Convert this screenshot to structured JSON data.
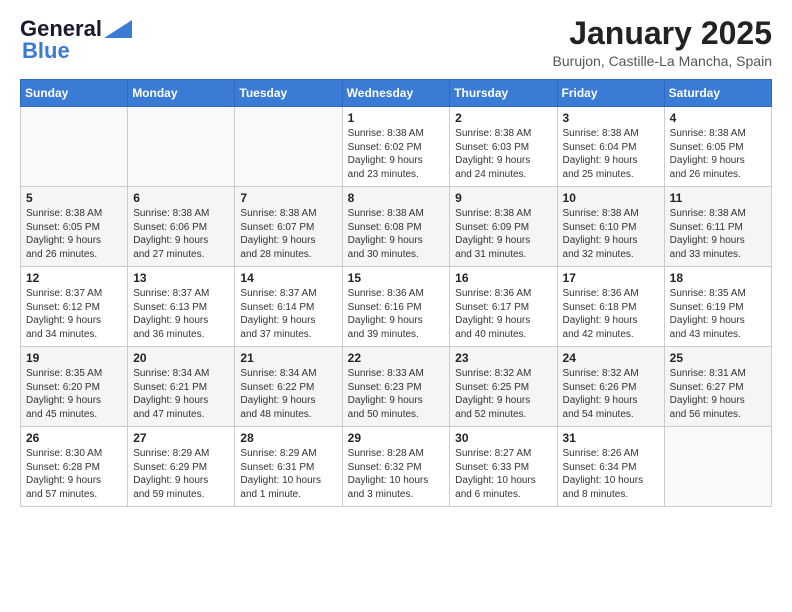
{
  "header": {
    "logo_blue": "Blue",
    "month_title": "January 2025",
    "subtitle": "Burujon, Castille-La Mancha, Spain"
  },
  "calendar": {
    "days": [
      "Sunday",
      "Monday",
      "Tuesday",
      "Wednesday",
      "Thursday",
      "Friday",
      "Saturday"
    ]
  },
  "weeks": [
    [
      {
        "day": "",
        "info": ""
      },
      {
        "day": "",
        "info": ""
      },
      {
        "day": "",
        "info": ""
      },
      {
        "day": "1",
        "info": "Sunrise: 8:38 AM\nSunset: 6:02 PM\nDaylight: 9 hours\nand 23 minutes."
      },
      {
        "day": "2",
        "info": "Sunrise: 8:38 AM\nSunset: 6:03 PM\nDaylight: 9 hours\nand 24 minutes."
      },
      {
        "day": "3",
        "info": "Sunrise: 8:38 AM\nSunset: 6:04 PM\nDaylight: 9 hours\nand 25 minutes."
      },
      {
        "day": "4",
        "info": "Sunrise: 8:38 AM\nSunset: 6:05 PM\nDaylight: 9 hours\nand 26 minutes."
      }
    ],
    [
      {
        "day": "5",
        "info": "Sunrise: 8:38 AM\nSunset: 6:05 PM\nDaylight: 9 hours\nand 26 minutes."
      },
      {
        "day": "6",
        "info": "Sunrise: 8:38 AM\nSunset: 6:06 PM\nDaylight: 9 hours\nand 27 minutes."
      },
      {
        "day": "7",
        "info": "Sunrise: 8:38 AM\nSunset: 6:07 PM\nDaylight: 9 hours\nand 28 minutes."
      },
      {
        "day": "8",
        "info": "Sunrise: 8:38 AM\nSunset: 6:08 PM\nDaylight: 9 hours\nand 30 minutes."
      },
      {
        "day": "9",
        "info": "Sunrise: 8:38 AM\nSunset: 6:09 PM\nDaylight: 9 hours\nand 31 minutes."
      },
      {
        "day": "10",
        "info": "Sunrise: 8:38 AM\nSunset: 6:10 PM\nDaylight: 9 hours\nand 32 minutes."
      },
      {
        "day": "11",
        "info": "Sunrise: 8:38 AM\nSunset: 6:11 PM\nDaylight: 9 hours\nand 33 minutes."
      }
    ],
    [
      {
        "day": "12",
        "info": "Sunrise: 8:37 AM\nSunset: 6:12 PM\nDaylight: 9 hours\nand 34 minutes."
      },
      {
        "day": "13",
        "info": "Sunrise: 8:37 AM\nSunset: 6:13 PM\nDaylight: 9 hours\nand 36 minutes."
      },
      {
        "day": "14",
        "info": "Sunrise: 8:37 AM\nSunset: 6:14 PM\nDaylight: 9 hours\nand 37 minutes."
      },
      {
        "day": "15",
        "info": "Sunrise: 8:36 AM\nSunset: 6:16 PM\nDaylight: 9 hours\nand 39 minutes."
      },
      {
        "day": "16",
        "info": "Sunrise: 8:36 AM\nSunset: 6:17 PM\nDaylight: 9 hours\nand 40 minutes."
      },
      {
        "day": "17",
        "info": "Sunrise: 8:36 AM\nSunset: 6:18 PM\nDaylight: 9 hours\nand 42 minutes."
      },
      {
        "day": "18",
        "info": "Sunrise: 8:35 AM\nSunset: 6:19 PM\nDaylight: 9 hours\nand 43 minutes."
      }
    ],
    [
      {
        "day": "19",
        "info": "Sunrise: 8:35 AM\nSunset: 6:20 PM\nDaylight: 9 hours\nand 45 minutes."
      },
      {
        "day": "20",
        "info": "Sunrise: 8:34 AM\nSunset: 6:21 PM\nDaylight: 9 hours\nand 47 minutes."
      },
      {
        "day": "21",
        "info": "Sunrise: 8:34 AM\nSunset: 6:22 PM\nDaylight: 9 hours\nand 48 minutes."
      },
      {
        "day": "22",
        "info": "Sunrise: 8:33 AM\nSunset: 6:23 PM\nDaylight: 9 hours\nand 50 minutes."
      },
      {
        "day": "23",
        "info": "Sunrise: 8:32 AM\nSunset: 6:25 PM\nDaylight: 9 hours\nand 52 minutes."
      },
      {
        "day": "24",
        "info": "Sunrise: 8:32 AM\nSunset: 6:26 PM\nDaylight: 9 hours\nand 54 minutes."
      },
      {
        "day": "25",
        "info": "Sunrise: 8:31 AM\nSunset: 6:27 PM\nDaylight: 9 hours\nand 56 minutes."
      }
    ],
    [
      {
        "day": "26",
        "info": "Sunrise: 8:30 AM\nSunset: 6:28 PM\nDaylight: 9 hours\nand 57 minutes."
      },
      {
        "day": "27",
        "info": "Sunrise: 8:29 AM\nSunset: 6:29 PM\nDaylight: 9 hours\nand 59 minutes."
      },
      {
        "day": "28",
        "info": "Sunrise: 8:29 AM\nSunset: 6:31 PM\nDaylight: 10 hours\nand 1 minute."
      },
      {
        "day": "29",
        "info": "Sunrise: 8:28 AM\nSunset: 6:32 PM\nDaylight: 10 hours\nand 3 minutes."
      },
      {
        "day": "30",
        "info": "Sunrise: 8:27 AM\nSunset: 6:33 PM\nDaylight: 10 hours\nand 6 minutes."
      },
      {
        "day": "31",
        "info": "Sunrise: 8:26 AM\nSunset: 6:34 PM\nDaylight: 10 hours\nand 8 minutes."
      },
      {
        "day": "",
        "info": ""
      }
    ]
  ]
}
